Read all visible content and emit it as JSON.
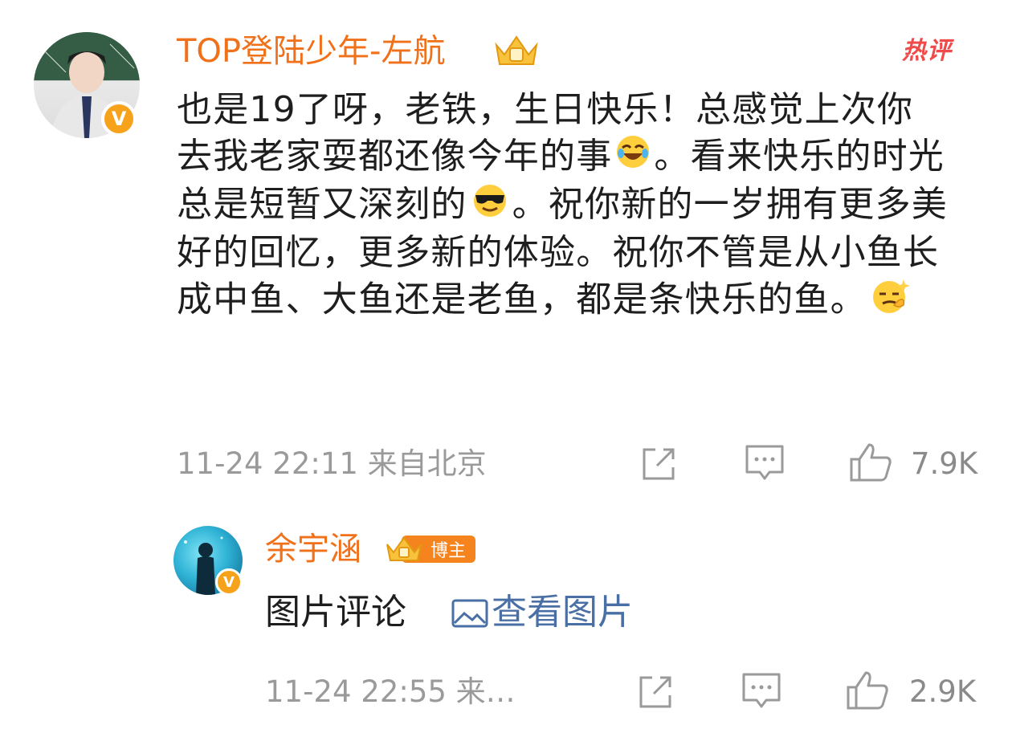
{
  "main_comment": {
    "username": "TOP登陆少年-左航",
    "hot_label": "热评",
    "text": [
      {
        "t": "也是19了呀，老铁，生日快乐！总感觉上次你去我老家耍都还像今年的事"
      },
      {
        "emoji": "laugh-cry-emoji"
      },
      {
        "t": "。看来快乐的时光总是短暂又深刻的"
      },
      {
        "emoji": "sunglasses-emoji"
      },
      {
        "t": "。祝你新的一岁拥有更多美好的回忆，更多新的体验。祝你不管是从小鱼长成中鱼、大鱼还是老鱼，都是条快乐的鱼。"
      },
      {
        "emoji": "smirk-emoji"
      }
    ],
    "meta": "11-24 22:11  来自北京",
    "like_count": "7.9K"
  },
  "reply": {
    "username": "余宇涵",
    "author_badge": "博主",
    "text": "图片评论",
    "link_text": "查看图片",
    "meta": "11-24 22:55  来…",
    "like_count": "2.9K"
  },
  "colors": {
    "username": "#f0711a",
    "hot": "#f04b4b",
    "link": "#4a6fa5",
    "meta": "#9a9a9a",
    "vip_badge": "#f7a21b"
  }
}
